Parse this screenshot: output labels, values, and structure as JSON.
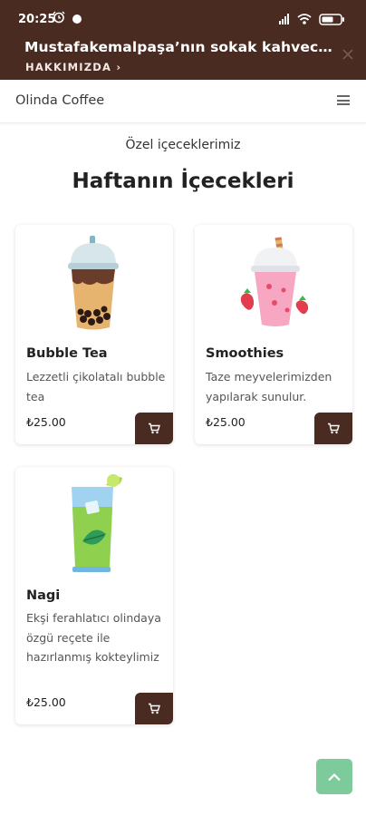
{
  "status_bar": {
    "time": "20:25",
    "icons": [
      "alarm-icon",
      "dot-icon",
      "signal-icon",
      "wifi-icon",
      "battery-icon"
    ]
  },
  "announcement": {
    "text": "Mustafakemalpaşa’nın sokak kahvecisi...",
    "link_label": "HAKKIMIZDA",
    "link_chevron": "›",
    "close_icon": "close-icon"
  },
  "navbar": {
    "brand": "Olinda Coffee",
    "menu_icon": "hamburger-icon"
  },
  "section": {
    "subtitle": "Özel içeceklerimiz",
    "title": "Haftanın İçecekleri"
  },
  "products": [
    {
      "name": "Bubble Tea",
      "description": "Lezzetli çikolatalı bubble tea",
      "price": "₺25.00",
      "icon": "bubble-tea-icon"
    },
    {
      "name": "Smoothies",
      "description": "Taze meyvelerimizden yapılarak sunulur.",
      "price": "₺25.00",
      "icon": "smoothie-icon"
    },
    {
      "name": "Nagi",
      "description": "Ekşi ferahlatıcı olindaya özgü reçete ile hazırlanmış kokteylimiz",
      "price": "₺25.00",
      "icon": "cocktail-icon"
    }
  ],
  "colors": {
    "brand_brown": "#4a2b21",
    "scroll_button_green": "#7dcb9b"
  },
  "scroll_top_icon": "chevron-up-icon"
}
